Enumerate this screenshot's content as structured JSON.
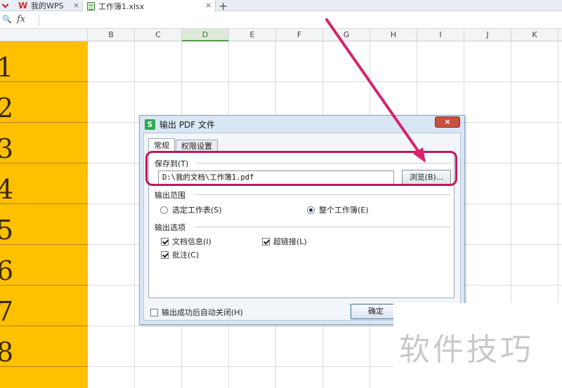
{
  "tabs": [
    {
      "label": "我的WPS",
      "close": "×"
    },
    {
      "label": "工作簿1.xlsx",
      "close": "×"
    }
  ],
  "new_tab": "+",
  "formula_bar": {
    "fx": "fx",
    "zoom": "🔍"
  },
  "columns": [
    "B",
    "C",
    "D",
    "E",
    "F",
    "G",
    "H",
    "I",
    "J",
    "K"
  ],
  "active_column": "D",
  "row_numbers": [
    "1",
    "2",
    "3",
    "4",
    "5",
    "6",
    "7",
    "8"
  ],
  "dialog": {
    "logo": "S",
    "title": "输出 PDF 文件",
    "close": "×",
    "tabs": [
      "常规",
      "权限设置"
    ],
    "save_to_label": "保存到(T)",
    "path": "D:\\我的文档\\工作簿1.pdf",
    "browse": "浏览(B)...",
    "range_label": "输出范围",
    "range_options": [
      {
        "label": "选定工作表(S)",
        "checked": false
      },
      {
        "label": "整个工作簿(E)",
        "checked": true
      }
    ],
    "options_label": "输出选项",
    "options": [
      {
        "label": "文档信息(I)",
        "checked": true
      },
      {
        "label": "超链接(L)",
        "checked": true
      },
      {
        "label": "批注(C)",
        "checked": true
      }
    ],
    "auto_close": "输出成功后自动关闭(H)",
    "ok": "确定"
  },
  "watermark": "软件技巧",
  "colors": {
    "row_fill": "#ffc000",
    "highlight": "#c2185b",
    "arrow": "#d6246a"
  }
}
